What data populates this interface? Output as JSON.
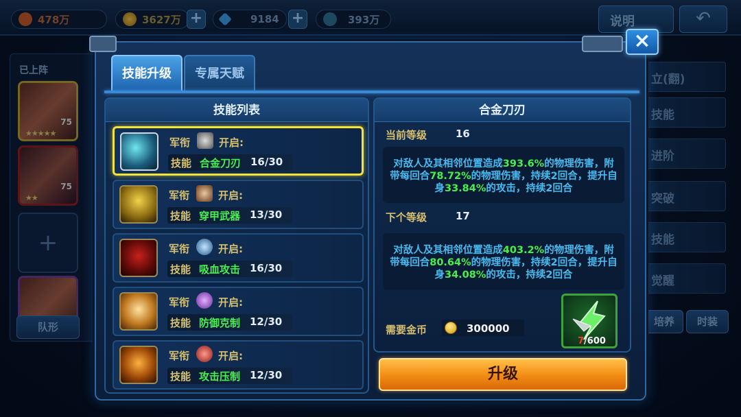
{
  "topbar": {
    "stat1_value": "478万",
    "gold_value": "3627万",
    "diamond_value": "9184",
    "energy_value": "393万",
    "help_label": "说明",
    "back_icon": "back-arrow-icon",
    "plus": "+"
  },
  "background_left": {
    "label": "已上阵",
    "heroes": [
      {
        "level": "75",
        "stars": "★★★★★"
      },
      {
        "level": "75",
        "stars": "★★"
      }
    ],
    "add_slot": "+",
    "formation_label": "队形"
  },
  "background_right": {
    "items": [
      "立(翻)",
      "技能",
      "进阶",
      "突破",
      "技能",
      "觉醒"
    ],
    "bottom_buttons": [
      "培养",
      "时装"
    ]
  },
  "modal": {
    "tabs": [
      {
        "label": "技能升级",
        "active": true
      },
      {
        "label": "专属天赋",
        "active": false
      }
    ],
    "close_icon": "×",
    "skill_list_title": "技能列表",
    "skills": [
      {
        "rank_label": "军衔",
        "open_label": "开启:",
        "skill_label": "技能",
        "name": "合金刀刃",
        "progress": "16/30",
        "selected": true
      },
      {
        "rank_label": "军衔",
        "open_label": "开启:",
        "skill_label": "技能",
        "name": "穿甲武器",
        "progress": "13/30",
        "selected": false
      },
      {
        "rank_label": "军衔",
        "open_label": "开启:",
        "skill_label": "技能",
        "name": "吸血攻击",
        "progress": "16/30",
        "selected": false
      },
      {
        "rank_label": "军衔",
        "open_label": "开启:",
        "skill_label": "技能",
        "name": "防御克制",
        "progress": "12/30",
        "selected": false
      },
      {
        "rank_label": "军衔",
        "open_label": "开启:",
        "skill_label": "技能",
        "name": "攻击压制",
        "progress": "12/30",
        "selected": false
      }
    ],
    "detail": {
      "title": "合金刀刃",
      "current_label": "当前等级",
      "current_level": "16",
      "current_desc": {
        "p1": "对敌人及其相邻位置造成",
        "v1": "393.6%",
        "p2": "的物理伤害",
        "p3": "，附带每回合",
        "v2": "78.72%",
        "p4": "的物理伤害，持续2回合",
        "p5": "，提升自身",
        "v3": "33.84%",
        "p6": "的攻击，持续2回合"
      },
      "next_label": "下个等级",
      "next_level": "17",
      "next_desc": {
        "p1": "对敌人及其相邻位置造成",
        "v1": "403.2%",
        "p2": "的物理伤害",
        "p3": "，附带每回合",
        "v2": "80.64%",
        "p4": "的物理伤害，持续2回合",
        "p5": "，提升自身",
        "v3": "34.08%",
        "p6": "的攻击，持续2回合"
      },
      "cost_label": "需要金币",
      "cost_value": "300000",
      "item_have": "7",
      "item_need": "/600",
      "upgrade_label": "升级"
    }
  }
}
